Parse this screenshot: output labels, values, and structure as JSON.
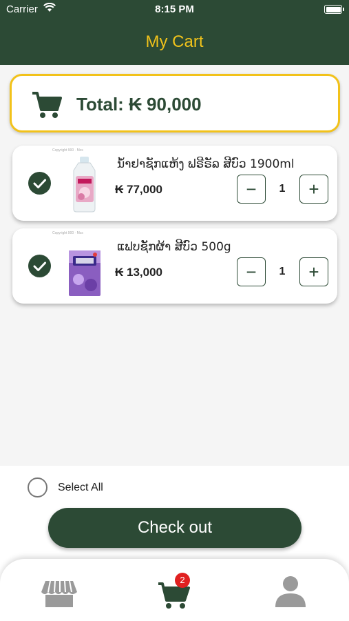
{
  "status_bar": {
    "carrier": "Carrier",
    "time": "8:15 PM"
  },
  "header": {
    "title": "My Cart"
  },
  "total": {
    "label": "Total: ₭ 90,000"
  },
  "items": [
    {
      "name": "ນ້ຳຢາຊັກແຫ້ງ ຟຣີຣັລ ສີບົວ 1900ml",
      "price": "₭ 77,000",
      "quantity": "1",
      "selected": true,
      "thumb_caption": "Copyright 900 · Mcs"
    },
    {
      "name": "ແຟບຊັກຜ້າ ສີບົວ 500g",
      "price": "₭ 13,000",
      "quantity": "1",
      "selected": true,
      "thumb_caption": "Copyright 900 · Mcs"
    }
  ],
  "footer": {
    "select_all_label": "Select All",
    "checkout_label": "Check out"
  },
  "tabbar": {
    "cart_badge": "2",
    "active_tab": "cart",
    "active_color": "#2c4a35",
    "inactive_color": "#9a9a9a"
  },
  "colors": {
    "primary": "#2c4a35",
    "accent": "#f0c21b",
    "badge": "#e02020"
  }
}
